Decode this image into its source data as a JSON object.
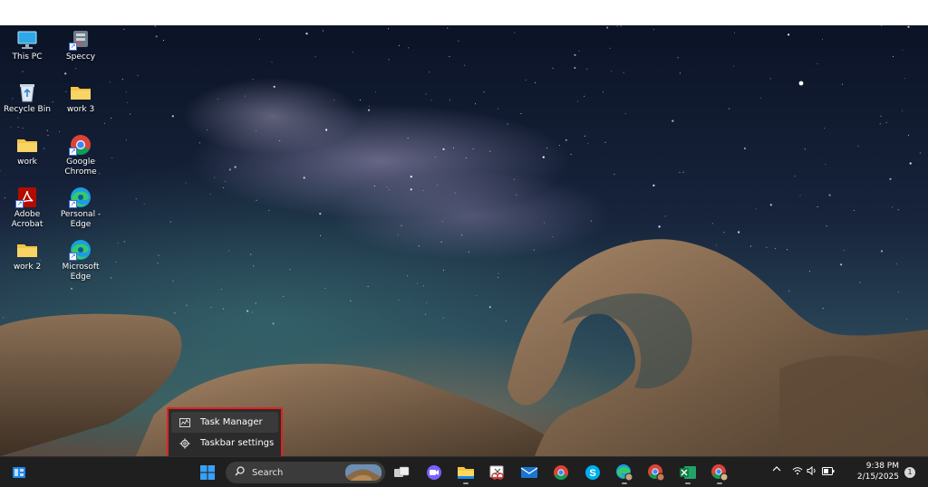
{
  "desktop": {
    "icons": [
      {
        "label": "This PC",
        "icon": "monitor-icon"
      },
      {
        "label": "Speccy",
        "icon": "speccy-icon"
      },
      {
        "label": "Recycle Bin",
        "icon": "recycle-bin-icon"
      },
      {
        "label": "work 3",
        "icon": "folder-icon"
      },
      {
        "label": "work",
        "icon": "folder-icon"
      },
      {
        "label": "Google\nChrome",
        "icon": "chrome-icon"
      },
      {
        "label": "Adobe\nAcrobat",
        "icon": "acrobat-icon"
      },
      {
        "label": "Personal -\nEdge",
        "icon": "edge-icon"
      },
      {
        "label": "work 2",
        "icon": "folder-icon"
      },
      {
        "label": "Microsoft\nEdge",
        "icon": "edge-icon"
      }
    ]
  },
  "context_menu": {
    "items": [
      {
        "label": "Task Manager",
        "icon": "task-manager-icon"
      },
      {
        "label": "Taskbar settings",
        "icon": "gear-icon"
      }
    ],
    "highlight_color": "#e02222"
  },
  "taskbar": {
    "search_placeholder": "Search",
    "apps": [
      {
        "name": "start",
        "icon": "windows-start-icon"
      },
      {
        "name": "task-view",
        "icon": "task-view-icon"
      },
      {
        "name": "zoom",
        "icon": "zoom-icon"
      },
      {
        "name": "file-explorer",
        "icon": "folder-icon"
      },
      {
        "name": "snipping-tool",
        "icon": "snipping-tool-icon"
      },
      {
        "name": "mail",
        "icon": "mail-icon"
      },
      {
        "name": "chrome",
        "icon": "chrome-icon"
      },
      {
        "name": "skype",
        "icon": "skype-icon"
      },
      {
        "name": "edge-profile",
        "icon": "edge-icon"
      },
      {
        "name": "chrome-profile",
        "icon": "chrome-icon"
      },
      {
        "name": "excel",
        "icon": "excel-icon"
      },
      {
        "name": "chrome-2",
        "icon": "chrome-icon"
      }
    ]
  },
  "tray": {
    "time": "9:38 PM",
    "date": "2/15/2025",
    "notification_count": "1",
    "icons": [
      "chevron-up-icon",
      "wifi-icon",
      "speaker-icon",
      "battery-icon"
    ]
  }
}
